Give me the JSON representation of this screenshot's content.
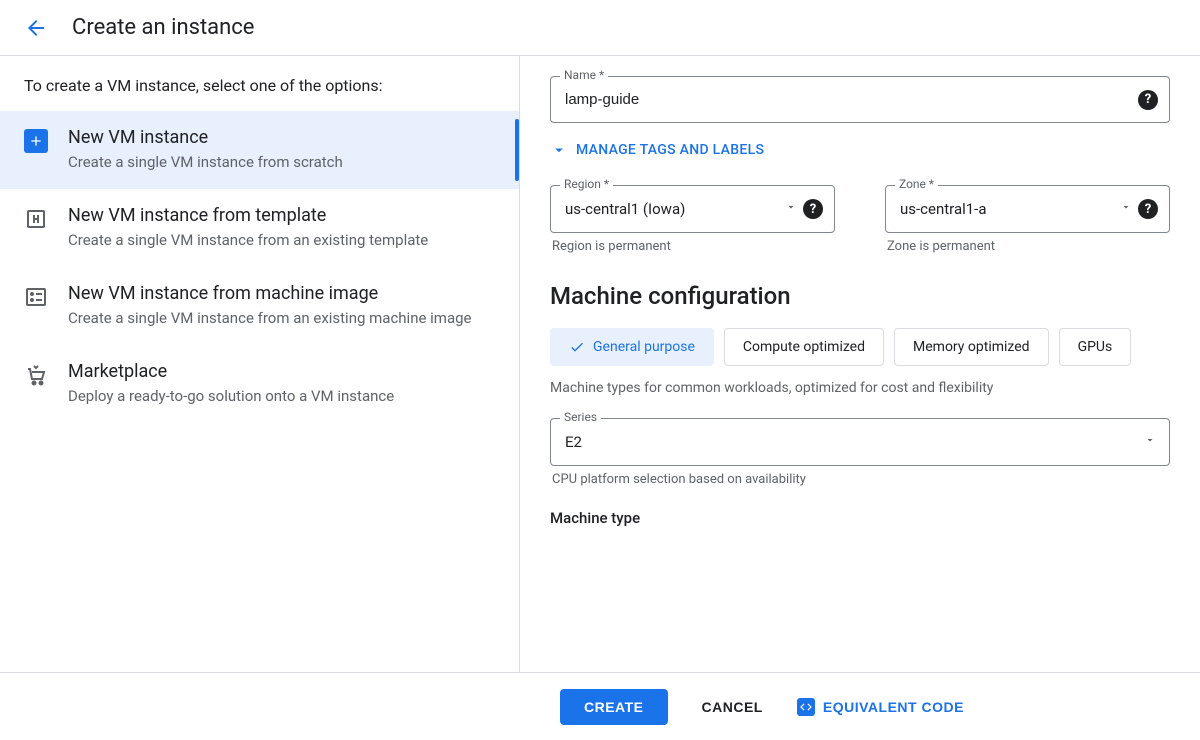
{
  "header": {
    "title": "Create an instance"
  },
  "left": {
    "intro": "To create a VM instance, select one of the options:",
    "options": [
      {
        "title": "New VM instance",
        "desc": "Create a single VM instance from scratch"
      },
      {
        "title": "New VM instance from template",
        "desc": "Create a single VM instance from an existing template"
      },
      {
        "title": "New VM instance from machine image",
        "desc": "Create a single VM instance from an existing machine image"
      },
      {
        "title": "Marketplace",
        "desc": "Deploy a ready-to-go solution onto a VM instance"
      }
    ]
  },
  "form": {
    "name": {
      "label": "Name *",
      "value": "lamp-guide"
    },
    "manage_tags": "MANAGE TAGS AND LABELS",
    "region": {
      "label": "Region *",
      "value": "us-central1 (Iowa)",
      "helper": "Region is permanent"
    },
    "zone": {
      "label": "Zone *",
      "value": "us-central1-a",
      "helper": "Zone is permanent"
    },
    "machine_config_heading": "Machine configuration",
    "tabs": {
      "general": "General purpose",
      "compute": "Compute optimized",
      "memory": "Memory optimized",
      "gpus": "GPUs"
    },
    "tab_desc": "Machine types for common workloads, optimized for cost and flexibility",
    "series": {
      "label": "Series",
      "value": "E2",
      "helper": "CPU platform selection based on availability"
    },
    "machine_type_label": "Machine type"
  },
  "footer": {
    "create": "CREATE",
    "cancel": "CANCEL",
    "code": "EQUIVALENT CODE"
  }
}
